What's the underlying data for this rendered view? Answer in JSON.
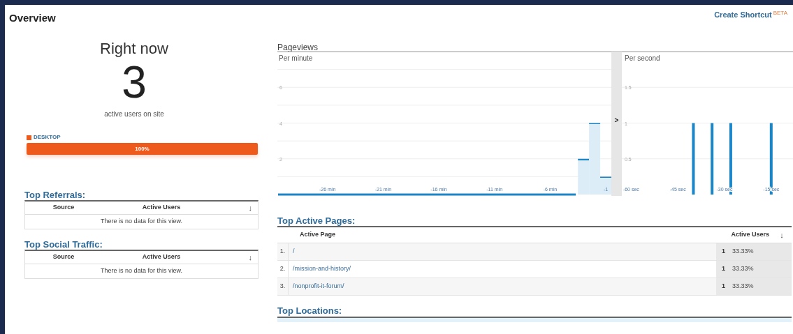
{
  "header": {
    "title": "Overview",
    "shortcut": "Create Shortcut",
    "shortcut_badge": "BETA"
  },
  "right_now": {
    "title": "Right now",
    "count": "3",
    "caption": "active users on site",
    "devices": [
      {
        "label": "DESKTOP",
        "color": "#ee5a1c",
        "level": 1,
        "reading": "100%"
      }
    ]
  },
  "pageviews": {
    "title": "Pageviews",
    "per_minute": {
      "label": "Per minute",
      "chart_data": {
        "type": "bar",
        "x": [
          -3,
          -2,
          -1
        ],
        "values": [
          2,
          4,
          1
        ],
        "xlim": [
          -30.5,
          -0.5
        ],
        "ylim": [
          0,
          8
        ],
        "grid": true,
        "yticks": [
          2,
          4,
          6
        ],
        "xticks": [
          {
            "value": -26,
            "label": "-26 min"
          },
          {
            "value": -21,
            "label": "-21 min"
          },
          {
            "value": -16,
            "label": "-16 min"
          },
          {
            "value": -11,
            "label": "-11 min"
          },
          {
            "value": -6,
            "label": "-6 min"
          },
          {
            "value": -1,
            "label": "-1"
          }
        ]
      }
    },
    "expand": ">",
    "per_second": {
      "label": "Per second",
      "chart_data": {
        "type": "bar",
        "x": [
          -40,
          -34,
          -28,
          -15
        ],
        "values": [
          1,
          1,
          1,
          1
        ],
        "xlim": [
          -63,
          -8
        ],
        "ylim": [
          0,
          2
        ],
        "grid": true,
        "yticks": [
          0.5,
          1,
          1.5
        ],
        "xticks": [
          {
            "value": -60,
            "label": "-60 sec"
          },
          {
            "value": -45,
            "label": "-45 sec"
          },
          {
            "value": -30,
            "label": "-30 sec"
          },
          {
            "value": -15,
            "label": "-15 sec"
          }
        ]
      }
    }
  },
  "left_tables": [
    {
      "title": "Top Referrals:",
      "columns": [
        "Source",
        "Active Users"
      ],
      "sort": "↓",
      "empty": "There is no data for this view."
    },
    {
      "title": "Top Social Traffic:",
      "columns": [
        "Source",
        "Active Users"
      ],
      "sort": "↓",
      "empty": "There is no data for this view."
    }
  ],
  "top_pages": {
    "title": "Top Active Pages:",
    "columns": [
      "Active Page",
      "Active Users"
    ],
    "sort": "↓",
    "rows": [
      {
        "index": "1.",
        "page": "/",
        "users": "1",
        "percent": "33.33%"
      },
      {
        "index": "2.",
        "page": "/mission-and-history/",
        "users": "1",
        "percent": "33.33%"
      },
      {
        "index": "3.",
        "page": "/nonprofit-it-forum/",
        "users": "1",
        "percent": "33.33%"
      }
    ]
  },
  "top_locations": {
    "title": "Top Locations:"
  }
}
